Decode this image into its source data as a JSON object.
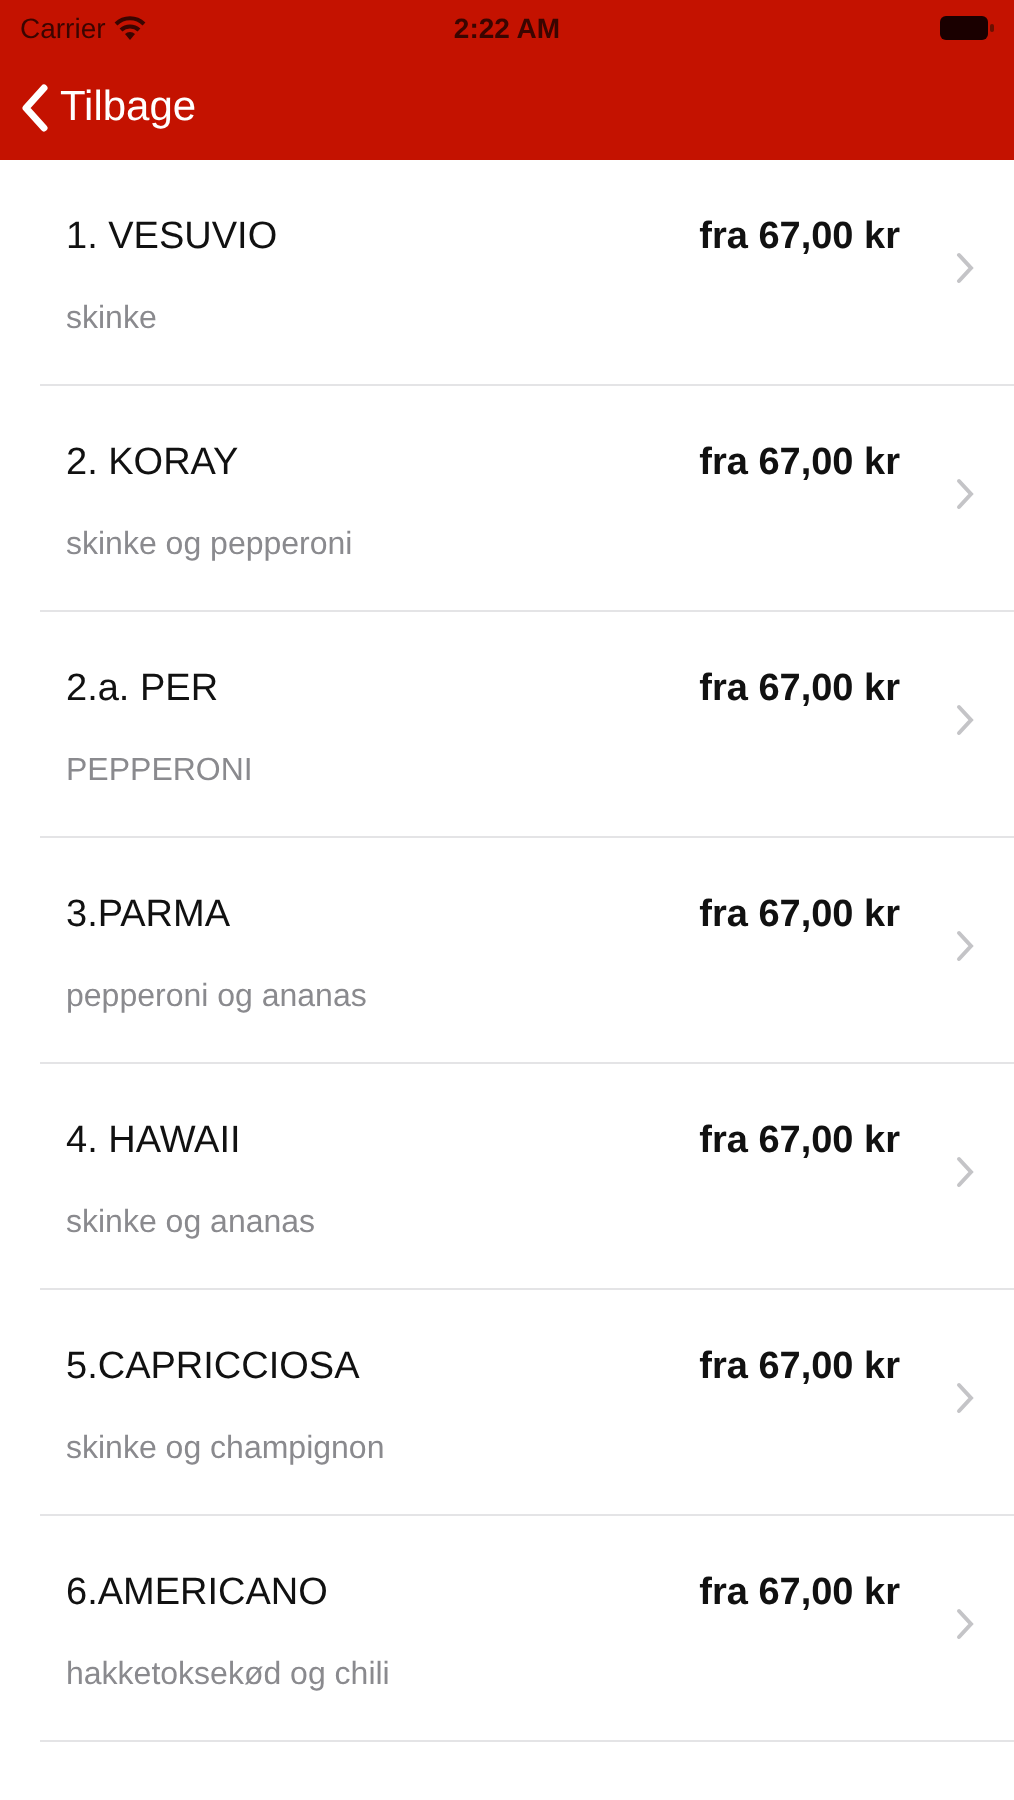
{
  "status_bar": {
    "carrier": "Carrier",
    "time": "2:22 AM"
  },
  "nav": {
    "back": "Tilbage"
  },
  "items": [
    {
      "name": "1. VESUVIO",
      "description": "skinke",
      "price": "fra 67,00 kr"
    },
    {
      "name": "2. KORAY",
      "description": "skinke og pepperoni",
      "price": "fra 67,00 kr"
    },
    {
      "name": "2.a. PER",
      "description": "PEPPERONI",
      "price": "fra 67,00 kr"
    },
    {
      "name": "3.PARMA",
      "description": "pepperoni og ananas",
      "price": "fra 67,00 kr"
    },
    {
      "name": "4. HAWAII",
      "description": "skinke og ananas",
      "price": "fra 67,00 kr"
    },
    {
      "name": "5.CAPRICCIOSA",
      "description": "skinke og champignon",
      "price": "fra 67,00 kr"
    },
    {
      "name": "6.AMERICANO",
      "description": "hakketoksekød og chili",
      "price": "fra 67,00 kr"
    }
  ]
}
